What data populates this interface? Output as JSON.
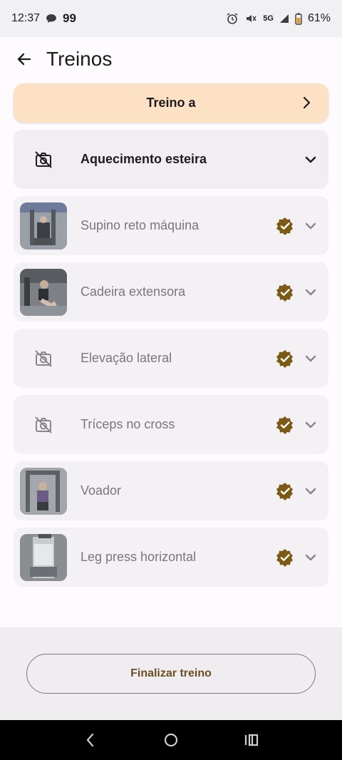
{
  "status_bar": {
    "time": "12:37",
    "badge_count": "99",
    "network": "5G",
    "battery": "61%"
  },
  "header": {
    "title": "Treinos",
    "back_icon": "arrow-left-icon"
  },
  "workout": {
    "label": "Treino a"
  },
  "exercises": [
    {
      "name": "Aquecimento esteira",
      "has_image": false,
      "done": false
    },
    {
      "name": "Supino reto máquina",
      "has_image": true,
      "done": true
    },
    {
      "name": "Cadeira extensora",
      "has_image": true,
      "done": true
    },
    {
      "name": "Elevação lateral",
      "has_image": false,
      "done": true
    },
    {
      "name": "Tríceps no cross",
      "has_image": false,
      "done": true
    },
    {
      "name": "Voador",
      "has_image": true,
      "done": true
    },
    {
      "name": "Leg press horizontal",
      "has_image": true,
      "done": true
    }
  ],
  "footer": {
    "finish_label": "Finalizar treino"
  },
  "colors": {
    "accent": "#fde1c4",
    "badge": "#7a5a14",
    "finish_text": "#6b4f22"
  }
}
